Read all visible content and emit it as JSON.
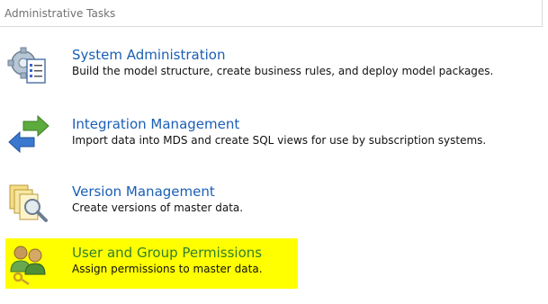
{
  "section": {
    "title": "Administrative Tasks"
  },
  "tasks": [
    {
      "title": "System Administration",
      "description": "Build the model structure, create business rules, and deploy model packages.",
      "icon": "gear-checklist-icon"
    },
    {
      "title": "Integration Management",
      "description": "Import data into MDS and create SQL views for use by subscription systems.",
      "icon": "arrows-exchange-icon"
    },
    {
      "title": "Version Management",
      "description": "Create versions of master data.",
      "icon": "documents-magnifier-icon"
    },
    {
      "title": "User and Group Permissions",
      "description": "Assign permissions to master data.",
      "icon": "users-key-icon",
      "highlight_color": "#ffff00"
    }
  ]
}
